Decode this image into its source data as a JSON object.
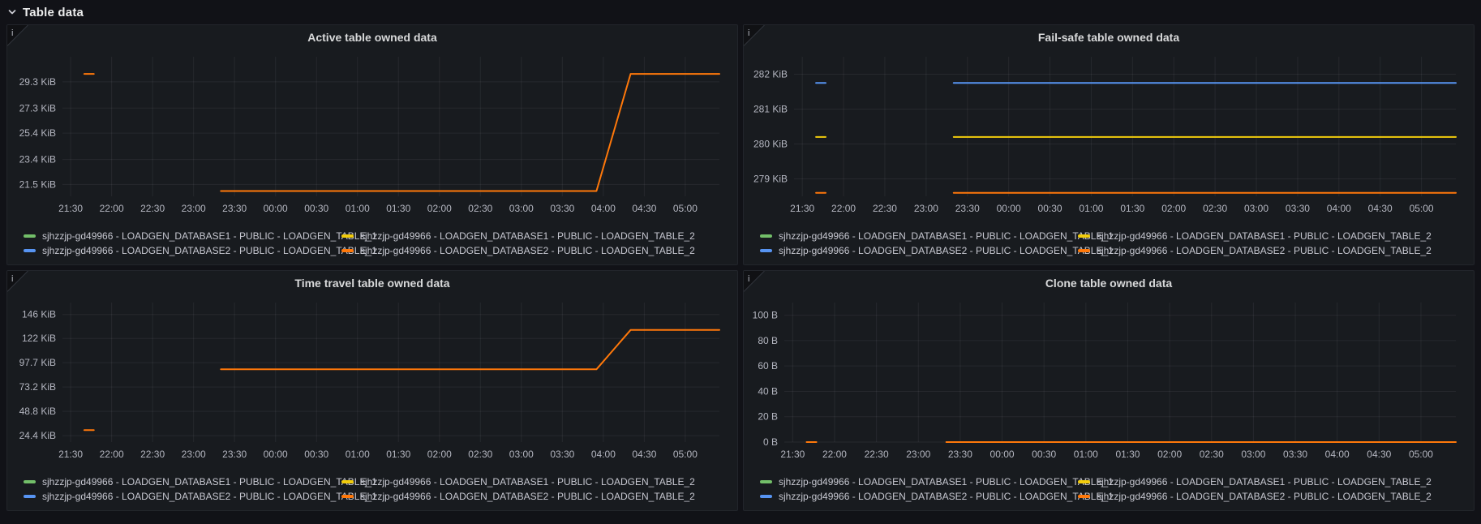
{
  "page": {
    "background": "#111217",
    "panel_background": "#181b1f",
    "grid_line": "rgba(204,204,220,0.08)",
    "tick_text": "#b4b6c0",
    "title_text": "#d8d9da",
    "legend_text": "#c7c8d1",
    "header_text": "#eceded"
  },
  "section": {
    "title": "Table data",
    "collapse_icon": "chevron-down-icon",
    "state": "expanded"
  },
  "colors": {
    "green": "#73BF69",
    "yellow": "#F2CC0C",
    "blue": "#5794F2",
    "orange": "#FF780A"
  },
  "panel_info_icon": "i",
  "chart_data": [
    {
      "type": "line",
      "title": "Active table owned data",
      "y_unit": "KiB",
      "y_range": [
        20.6,
        31.2
      ],
      "y_ticks": [
        {
          "value": 29.3,
          "label": "29.3 KiB"
        },
        {
          "value": 27.3,
          "label": "27.3 KiB"
        },
        {
          "value": 25.4,
          "label": "25.4 KiB"
        },
        {
          "value": 23.4,
          "label": "23.4 KiB"
        },
        {
          "value": 21.5,
          "label": "21.5 KiB"
        }
      ],
      "x_domain": [
        "21:24",
        "05:25"
      ],
      "x_tick_labels": [
        "21:30",
        "22:00",
        "22:30",
        "23:00",
        "23:30",
        "00:00",
        "00:30",
        "01:00",
        "01:30",
        "02:00",
        "02:30",
        "03:00",
        "03:30",
        "04:00",
        "04:30",
        "05:00"
      ],
      "grid": true,
      "legend_position": "bottom",
      "series": [
        {
          "name": "sjhzzjp-gd49966 - LOADGEN_DATABASE2 - PUBLIC - LOADGEN_TABLE_2",
          "color": "orange",
          "segments": [
            [
              [
                "21:40",
                29.9
              ],
              [
                "21:47",
                29.9
              ]
            ],
            [
              [
                "23:20",
                21.0
              ],
              [
                "03:55",
                21.0
              ],
              [
                "04:20",
                29.9
              ],
              [
                "05:25",
                29.9
              ]
            ]
          ]
        }
      ],
      "legend": [
        {
          "color": "green",
          "label": "sjhzzjp-gd49966 - LOADGEN_DATABASE1 - PUBLIC - LOADGEN_TABLE_1"
        },
        {
          "color": "yellow",
          "label": "sjhzzjp-gd49966 - LOADGEN_DATABASE1 - PUBLIC - LOADGEN_TABLE_2"
        },
        {
          "color": "blue",
          "label": "sjhzzjp-gd49966 - LOADGEN_DATABASE2 - PUBLIC - LOADGEN_TABLE_1"
        },
        {
          "color": "orange",
          "label": "sjhzzjp-gd49966 - LOADGEN_DATABASE2 - PUBLIC - LOADGEN_TABLE_2"
        }
      ]
    },
    {
      "type": "line",
      "title": "Fail-safe table owned data",
      "y_unit": "KiB",
      "y_range": [
        278.5,
        282.5
      ],
      "y_ticks": [
        {
          "value": 282,
          "label": "282 KiB"
        },
        {
          "value": 281,
          "label": "281 KiB"
        },
        {
          "value": 280,
          "label": "280 KiB"
        },
        {
          "value": 279,
          "label": "279 KiB"
        }
      ],
      "x_domain": [
        "21:24",
        "05:25"
      ],
      "x_tick_labels": [
        "21:30",
        "22:00",
        "22:30",
        "23:00",
        "23:30",
        "00:00",
        "00:30",
        "01:00",
        "01:30",
        "02:00",
        "02:30",
        "03:00",
        "03:30",
        "04:00",
        "04:30",
        "05:00"
      ],
      "grid": true,
      "legend_position": "bottom",
      "series": [
        {
          "name": "sjhzzjp-gd49966 - LOADGEN_DATABASE2 - PUBLIC - LOADGEN_TABLE_1",
          "color": "blue",
          "segments": [
            [
              [
                "21:40",
                281.75
              ],
              [
                "21:47",
                281.75
              ]
            ],
            [
              [
                "23:20",
                281.75
              ],
              [
                "05:25",
                281.75
              ]
            ]
          ]
        },
        {
          "name": "sjhzzjp-gd49966 - LOADGEN_DATABASE1 - PUBLIC - LOADGEN_TABLE_2",
          "color": "yellow",
          "segments": [
            [
              [
                "21:40",
                280.2
              ],
              [
                "21:47",
                280.2
              ]
            ],
            [
              [
                "23:20",
                280.2
              ],
              [
                "05:25",
                280.2
              ]
            ]
          ]
        },
        {
          "name": "sjhzzjp-gd49966 - LOADGEN_DATABASE2 - PUBLIC - LOADGEN_TABLE_2",
          "color": "orange",
          "segments": [
            [
              [
                "21:40",
                278.6
              ],
              [
                "21:47",
                278.6
              ]
            ],
            [
              [
                "23:20",
                278.6
              ],
              [
                "05:25",
                278.6
              ]
            ]
          ]
        }
      ],
      "legend": [
        {
          "color": "green",
          "label": "sjhzzjp-gd49966 - LOADGEN_DATABASE1 - PUBLIC - LOADGEN_TABLE_1"
        },
        {
          "color": "yellow",
          "label": "sjhzzjp-gd49966 - LOADGEN_DATABASE1 - PUBLIC - LOADGEN_TABLE_2"
        },
        {
          "color": "blue",
          "label": "sjhzzjp-gd49966 - LOADGEN_DATABASE2 - PUBLIC - LOADGEN_TABLE_1"
        },
        {
          "color": "orange",
          "label": "sjhzzjp-gd49966 - LOADGEN_DATABASE2 - PUBLIC - LOADGEN_TABLE_2"
        }
      ]
    },
    {
      "type": "line",
      "title": "Time travel table owned data",
      "y_unit": "KiB",
      "y_range": [
        18,
        158
      ],
      "y_ticks": [
        {
          "value": 146,
          "label": "146 KiB"
        },
        {
          "value": 122,
          "label": "122 KiB"
        },
        {
          "value": 97.7,
          "label": "97.7 KiB"
        },
        {
          "value": 73.2,
          "label": "73.2 KiB"
        },
        {
          "value": 48.8,
          "label": "48.8 KiB"
        },
        {
          "value": 24.4,
          "label": "24.4 KiB"
        }
      ],
      "x_domain": [
        "21:24",
        "05:25"
      ],
      "x_tick_labels": [
        "21:30",
        "22:00",
        "22:30",
        "23:00",
        "23:30",
        "00:00",
        "00:30",
        "01:00",
        "01:30",
        "02:00",
        "02:30",
        "03:00",
        "03:30",
        "04:00",
        "04:30",
        "05:00"
      ],
      "grid": true,
      "legend_position": "bottom",
      "series": [
        {
          "name": "sjhzzjp-gd49966 - LOADGEN_DATABASE2 - PUBLIC - LOADGEN_TABLE_2",
          "color": "orange",
          "segments": [
            [
              [
                "21:40",
                30
              ],
              [
                "21:47",
                30
              ]
            ],
            [
              [
                "23:20",
                91
              ],
              [
                "03:55",
                91
              ],
              [
                "04:20",
                130.5
              ],
              [
                "05:25",
                130.5
              ]
            ]
          ]
        }
      ],
      "legend": [
        {
          "color": "green",
          "label": "sjhzzjp-gd49966 - LOADGEN_DATABASE1 - PUBLIC - LOADGEN_TABLE_1"
        },
        {
          "color": "yellow",
          "label": "sjhzzjp-gd49966 - LOADGEN_DATABASE1 - PUBLIC - LOADGEN_TABLE_2"
        },
        {
          "color": "blue",
          "label": "sjhzzjp-gd49966 - LOADGEN_DATABASE2 - PUBLIC - LOADGEN_TABLE_1"
        },
        {
          "color": "orange",
          "label": "sjhzzjp-gd49966 - LOADGEN_DATABASE2 - PUBLIC - LOADGEN_TABLE_2"
        }
      ]
    },
    {
      "type": "line",
      "title": "Clone table owned data",
      "y_unit": "B",
      "y_range": [
        0,
        110
      ],
      "y_ticks": [
        {
          "value": 100,
          "label": "100 B"
        },
        {
          "value": 80,
          "label": "80 B"
        },
        {
          "value": 60,
          "label": "60 B"
        },
        {
          "value": 40,
          "label": "40 B"
        },
        {
          "value": 20,
          "label": "20 B"
        },
        {
          "value": 0,
          "label": "0 B"
        }
      ],
      "x_domain": [
        "21:24",
        "05:25"
      ],
      "x_tick_labels": [
        "21:30",
        "22:00",
        "22:30",
        "23:00",
        "23:30",
        "00:00",
        "00:30",
        "01:00",
        "01:30",
        "02:00",
        "02:30",
        "03:00",
        "03:30",
        "04:00",
        "04:30",
        "05:00"
      ],
      "grid": true,
      "legend_position": "bottom",
      "series": [
        {
          "name": "sjhzzjp-gd49966 - LOADGEN_DATABASE2 - PUBLIC - LOADGEN_TABLE_2",
          "color": "orange",
          "segments": [
            [
              [
                "21:40",
                0
              ],
              [
                "21:47",
                0
              ]
            ],
            [
              [
                "23:20",
                0
              ],
              [
                "05:25",
                0
              ]
            ]
          ]
        }
      ],
      "legend": [
        {
          "color": "green",
          "label": "sjhzzjp-gd49966 - LOADGEN_DATABASE1 - PUBLIC - LOADGEN_TABLE_1"
        },
        {
          "color": "yellow",
          "label": "sjhzzjp-gd49966 - LOADGEN_DATABASE1 - PUBLIC - LOADGEN_TABLE_2"
        },
        {
          "color": "blue",
          "label": "sjhzzjp-gd49966 - LOADGEN_DATABASE2 - PUBLIC - LOADGEN_TABLE_1"
        },
        {
          "color": "orange",
          "label": "sjhzzjp-gd49966 - LOADGEN_DATABASE2 - PUBLIC - LOADGEN_TABLE_2"
        }
      ]
    }
  ]
}
